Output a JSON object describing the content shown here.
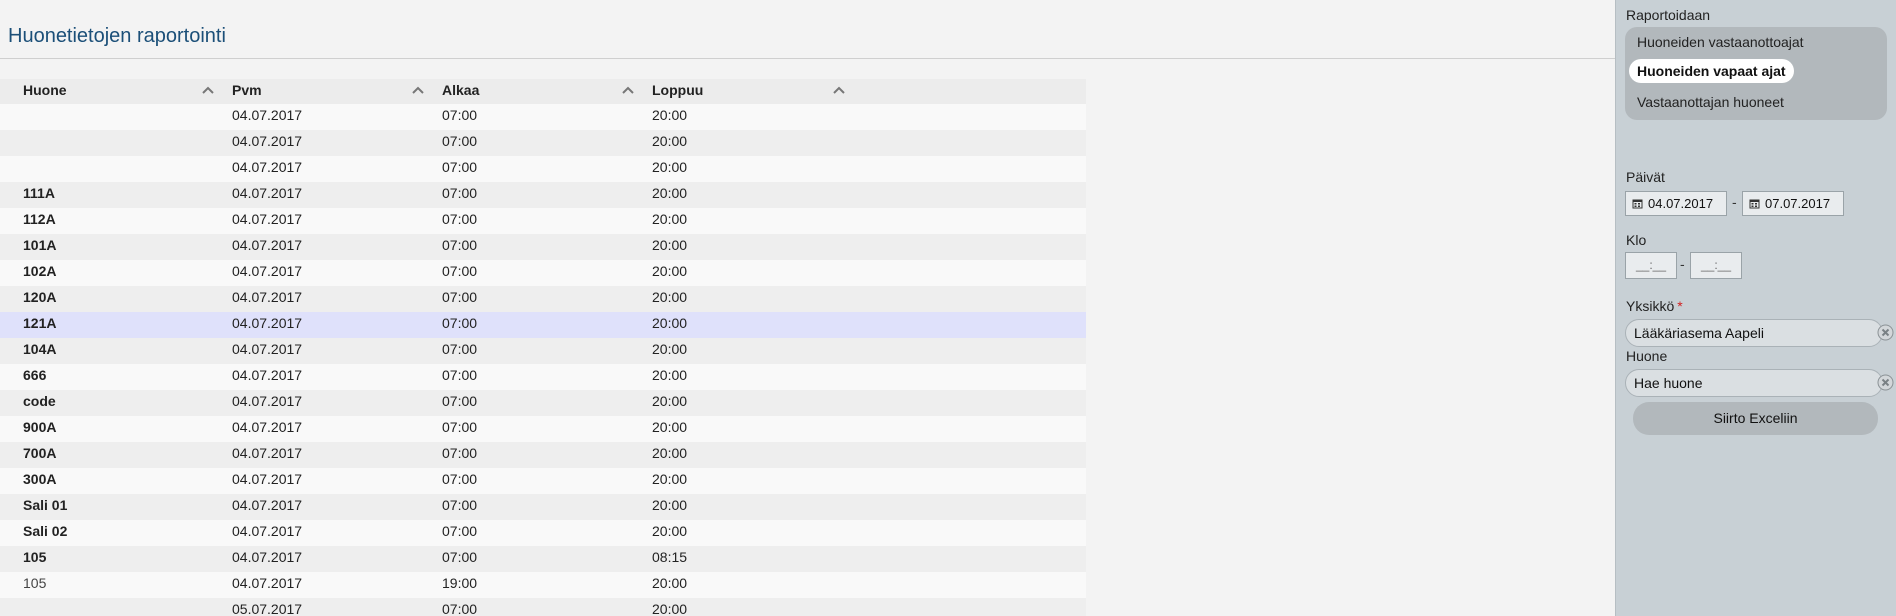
{
  "page_title": "Huonetietojen raportointi",
  "table": {
    "columns": [
      "Huone",
      "Pvm",
      "Alkaa",
      "Loppuu"
    ],
    "rows": [
      {
        "room": "",
        "date": "04.07.2017",
        "start": "07:00",
        "end": "20:00"
      },
      {
        "room": "",
        "date": "04.07.2017",
        "start": "07:00",
        "end": "20:00"
      },
      {
        "room": "",
        "date": "04.07.2017",
        "start": "07:00",
        "end": "20:00"
      },
      {
        "room": "111A",
        "date": "04.07.2017",
        "start": "07:00",
        "end": "20:00"
      },
      {
        "room": "112A",
        "date": "04.07.2017",
        "start": "07:00",
        "end": "20:00"
      },
      {
        "room": "101A",
        "date": "04.07.2017",
        "start": "07:00",
        "end": "20:00"
      },
      {
        "room": "102A",
        "date": "04.07.2017",
        "start": "07:00",
        "end": "20:00"
      },
      {
        "room": "120A",
        "date": "04.07.2017",
        "start": "07:00",
        "end": "20:00"
      },
      {
        "room": "121A",
        "date": "04.07.2017",
        "start": "07:00",
        "end": "20:00",
        "selected": true
      },
      {
        "room": "104A",
        "date": "04.07.2017",
        "start": "07:00",
        "end": "20:00"
      },
      {
        "room": "666",
        "date": "04.07.2017",
        "start": "07:00",
        "end": "20:00"
      },
      {
        "room": "code",
        "date": "04.07.2017",
        "start": "07:00",
        "end": "20:00"
      },
      {
        "room": "900A",
        "date": "04.07.2017",
        "start": "07:00",
        "end": "20:00"
      },
      {
        "room": "700A",
        "date": "04.07.2017",
        "start": "07:00",
        "end": "20:00"
      },
      {
        "room": "300A",
        "date": "04.07.2017",
        "start": "07:00",
        "end": "20:00"
      },
      {
        "room": "Sali 01",
        "date": "04.07.2017",
        "start": "07:00",
        "end": "20:00"
      },
      {
        "room": "Sali 02",
        "date": "04.07.2017",
        "start": "07:00",
        "end": "20:00"
      },
      {
        "room": "105",
        "date": "04.07.2017",
        "start": "07:00",
        "end": "08:15"
      },
      {
        "room": "105",
        "date": "04.07.2017",
        "start": "19:00",
        "end": "20:00",
        "plain": true
      },
      {
        "room": "",
        "date": "05.07.2017",
        "start": "07:00",
        "end": "20:00"
      }
    ]
  },
  "panel": {
    "report_label": "Raportoidaan",
    "modes": [
      {
        "label": "Huoneiden vastaanottoajat",
        "active": false
      },
      {
        "label": "Huoneiden vapaat ajat",
        "active": true
      },
      {
        "label": "Vastaanottajan huoneet",
        "active": false
      }
    ],
    "days_label": "Päivät",
    "date_from": "04.07.2017",
    "date_to": "07.07.2017",
    "range_separator": "-",
    "time_label": "Klo",
    "time_from_placeholder": "__:__",
    "time_to_placeholder": "__:__",
    "unit_label": "Yksikkö",
    "required_mark": "*",
    "unit_value": "Lääkäriasema Aapeli",
    "room_label": "Huone",
    "room_placeholder": "Hae huone",
    "export_label": "Siirto Exceliin"
  },
  "icons": {
    "sort": "chevron-up-icon",
    "calendar": "calendar-icon",
    "clear": "clear-icon"
  },
  "colors": {
    "title": "#1b4f78",
    "selected_row": "#dfe1fb",
    "panel_bg": "#c8d0d5",
    "required": "#d12020"
  }
}
